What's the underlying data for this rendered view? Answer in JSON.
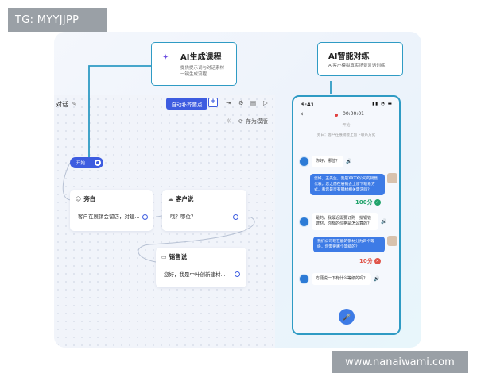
{
  "watermark_top": "TG: MYYJJPP",
  "watermark_bottom": "www.nanaiwami.com",
  "callout_course": {
    "title": "AI生成课程",
    "desc1": "提供提示词与对话素材",
    "desc2": "一键生成流程"
  },
  "callout_chat": {
    "title": "AI智能对练",
    "desc": "AI客户模拟真实场景对话训练"
  },
  "editor": {
    "title": "对话",
    "auto_button": "自动补齐要点",
    "save_template": "存为模版",
    "start_node": "开始",
    "nodes": [
      {
        "title": "旁白",
        "text": "客户在展销会留店，对建..."
      },
      {
        "title": "客户说",
        "text": "哦？哪位？"
      },
      {
        "title": "销售说",
        "text": "您好，我是中叶创新建材..."
      }
    ]
  },
  "phone": {
    "time": "9:41",
    "call_time": "00:00:01",
    "start_label": "开始",
    "system_note": "旁白：客户在展销会上留下联系方式",
    "messages": [
      {
        "role": "ai",
        "text": "你好，哪位？"
      },
      {
        "role": "user",
        "text": "您好，王先生，我是XXXX公司的销售代表。您之前在展销会上留下联系方式，看您是否有钢材相关需求吗？"
      },
      {
        "role": "ai",
        "text": "是的，我最近需要订购一批钢铁建材，你都的价格是怎么算的？"
      },
      {
        "role": "user",
        "text": "我们公司现在能的钢材分为四个等级，您需要哪个等级的？"
      },
      {
        "role": "ai",
        "text": "方便说一下有什么等级的吗？"
      }
    ],
    "scores": [
      "100分",
      "10分"
    ]
  },
  "colors": {
    "accent": "#3d5ce0",
    "callout_border": "#2f9bc4",
    "bubble_blue": "#3d7be6",
    "score_good": "#21a36b",
    "score_bad": "#e0554a"
  },
  "icons": [
    "sparkle-icon",
    "edit-icon",
    "plus-icon",
    "login-icon",
    "settings-icon",
    "save-icon",
    "play-icon",
    "sun-icon",
    "mic-icon",
    "speaker-icon",
    "back-icon"
  ]
}
